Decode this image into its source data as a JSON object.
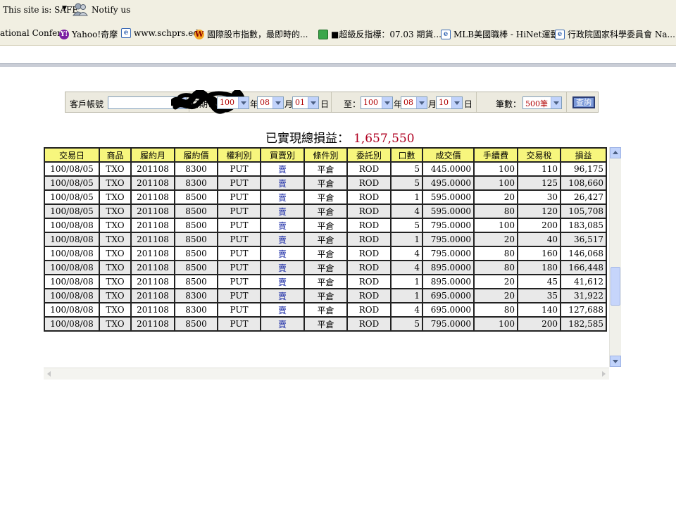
{
  "toolbar": {
    "safe_text": "This site is: SAFE",
    "notify_text": "Notify us"
  },
  "favorites": [
    {
      "label": "ational Confer...",
      "icon": "none"
    },
    {
      "label": "Yahoo!奇摩",
      "icon": "yahoo-icon"
    },
    {
      "label": "www.schprs.edu",
      "icon": "ie-page-icon"
    },
    {
      "label": "國際股市指數，最即時的...",
      "icon": "w-icon"
    },
    {
      "label": "■超級反指標：07.03 期貨...",
      "icon": "green-icon"
    },
    {
      "label": "MLB美國職棒 - HiNet運動",
      "icon": "ie-page-icon"
    },
    {
      "label": "行政院國家科學委員會 Na...",
      "icon": "ie-page-icon"
    }
  ],
  "filter": {
    "account_label": "客戶帳號",
    "date_label": "日期：",
    "from_year": "100",
    "year_unit": "年",
    "from_month": "08",
    "month_unit": "月",
    "from_day": "01",
    "day_unit": "日",
    "to_label": "至：",
    "to_year": "100",
    "to_month": "08",
    "to_day": "10",
    "count_label": "筆數：",
    "count_value": "500筆",
    "query_button": "查詢"
  },
  "summary": {
    "label": "已實現總損益：",
    "value": "1,657,550"
  },
  "table": {
    "headers": [
      "交易日",
      "商品",
      "履約月",
      "履約價",
      "權利別",
      "買賣別",
      "條件別",
      "委託別",
      "口數",
      "成交價",
      "手續費",
      "交易稅",
      "損益"
    ],
    "rows": [
      [
        "100/08/05",
        "TXO",
        "201108",
        "8300",
        "PUT",
        "賣",
        "平倉",
        "ROD",
        "5",
        "445.0000",
        "100",
        "110",
        "96,175"
      ],
      [
        "100/08/05",
        "TXO",
        "201108",
        "8300",
        "PUT",
        "賣",
        "平倉",
        "ROD",
        "5",
        "495.0000",
        "100",
        "125",
        "108,660"
      ],
      [
        "100/08/05",
        "TXO",
        "201108",
        "8500",
        "PUT",
        "賣",
        "平倉",
        "ROD",
        "1",
        "595.0000",
        "20",
        "30",
        "26,427"
      ],
      [
        "100/08/05",
        "TXO",
        "201108",
        "8500",
        "PUT",
        "賣",
        "平倉",
        "ROD",
        "4",
        "595.0000",
        "80",
        "120",
        "105,708"
      ],
      [
        "100/08/08",
        "TXO",
        "201108",
        "8500",
        "PUT",
        "賣",
        "平倉",
        "ROD",
        "5",
        "795.0000",
        "100",
        "200",
        "183,085"
      ],
      [
        "100/08/08",
        "TXO",
        "201108",
        "8500",
        "PUT",
        "賣",
        "平倉",
        "ROD",
        "1",
        "795.0000",
        "20",
        "40",
        "36,517"
      ],
      [
        "100/08/08",
        "TXO",
        "201108",
        "8500",
        "PUT",
        "賣",
        "平倉",
        "ROD",
        "4",
        "795.0000",
        "80",
        "160",
        "146,068"
      ],
      [
        "100/08/08",
        "TXO",
        "201108",
        "8500",
        "PUT",
        "賣",
        "平倉",
        "ROD",
        "4",
        "895.0000",
        "80",
        "180",
        "166,448"
      ],
      [
        "100/08/08",
        "TXO",
        "201108",
        "8500",
        "PUT",
        "賣",
        "平倉",
        "ROD",
        "1",
        "895.0000",
        "20",
        "45",
        "41,612"
      ],
      [
        "100/08/08",
        "TXO",
        "201108",
        "8300",
        "PUT",
        "賣",
        "平倉",
        "ROD",
        "1",
        "695.0000",
        "20",
        "35",
        "31,922"
      ],
      [
        "100/08/08",
        "TXO",
        "201108",
        "8300",
        "PUT",
        "賣",
        "平倉",
        "ROD",
        "4",
        "695.0000",
        "80",
        "140",
        "127,688"
      ],
      [
        "100/08/08",
        "TXO",
        "201108",
        "8500",
        "PUT",
        "賣",
        "平倉",
        "ROD",
        "5",
        "795.0000",
        "100",
        "200",
        "182,585"
      ]
    ]
  }
}
